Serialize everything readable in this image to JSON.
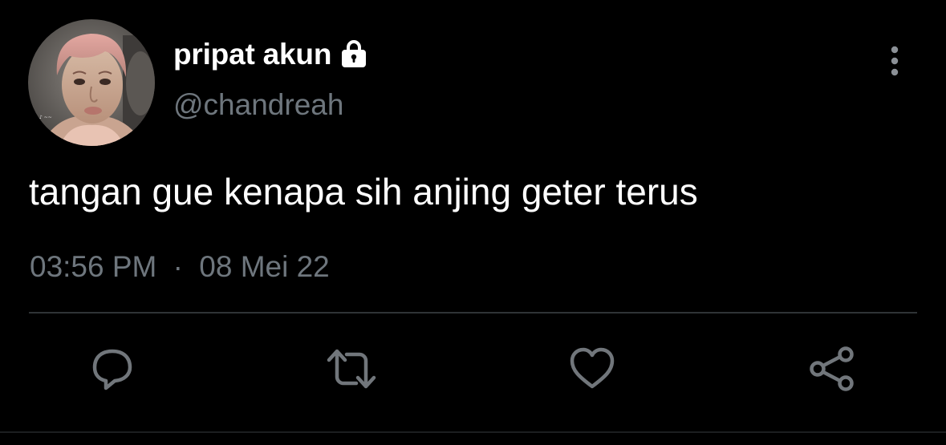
{
  "tweet": {
    "display_name": "pripat akun",
    "handle": "@chandreah",
    "text": "tangan gue kenapa sih anjing geter terus",
    "time": "03:56 PM",
    "separator": "·",
    "date": "08 Mei 22",
    "protected_icon": "lock-icon",
    "menu_icon": "more-vertical-icon"
  },
  "actions": [
    {
      "name": "reply",
      "icon": "reply-bubble-icon"
    },
    {
      "name": "retweet",
      "icon": "retweet-icon"
    },
    {
      "name": "like",
      "icon": "heart-icon"
    },
    {
      "name": "share",
      "icon": "share-icon"
    }
  ],
  "colors": {
    "background": "#000000",
    "primary_text": "#ffffff",
    "secondary_text": "#6e767d",
    "icon": "#71767b",
    "divider": "#2f3336"
  }
}
